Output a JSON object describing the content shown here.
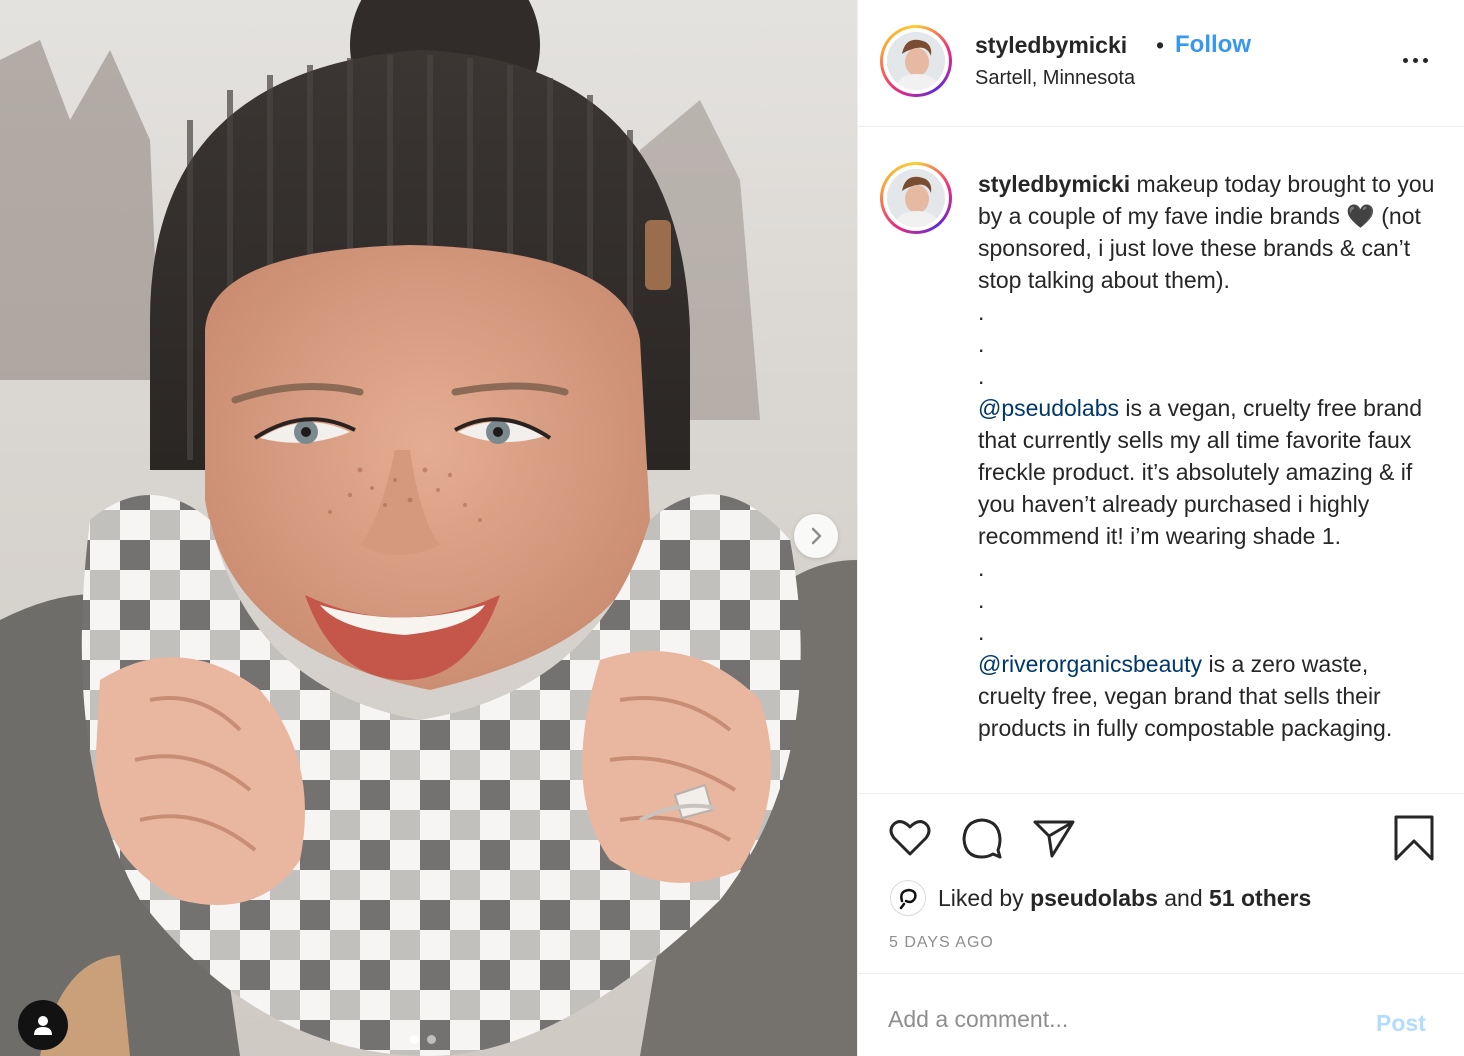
{
  "post": {
    "username": "styledbymicki",
    "separator": "•",
    "follow_label": "Follow",
    "location": "Sartell, Minnesota",
    "more_icon": "more-options-icon"
  },
  "caption": {
    "username": "styledbymicki",
    "intro": " makeup today brought to you by a couple of my fave indie brands 🖤 (not sponsored, i just love these brands & can’t stop talking about them).",
    "dot": ".",
    "mention1": "@pseudolabs",
    "para1": " is a vegan, cruelty free brand that currently sells my all time favorite faux freckle product. it’s absolutely amazing & if you haven’t already purchased i highly recommend it! i’m wearing shade 1.",
    "mention2": "@riverorganicsbeauty",
    "para2": " is a zero waste, cruelty free, vegan brand that sells their products in fully compostable packaging."
  },
  "likes": {
    "prefix": "Liked by ",
    "user": "pseudolabs",
    "middle": " and ",
    "count": "51 others"
  },
  "timestamp": "5 DAYS AGO",
  "comment": {
    "placeholder": "Add a comment...",
    "post_label": "Post"
  },
  "carousel": {
    "slide_count": 2,
    "active_index": 0
  },
  "colors": {
    "link_blue": "#3897f0",
    "mention_blue": "#00376b",
    "post_disabled": "#b3dbff",
    "meta_grey": "#8e8e8e"
  }
}
